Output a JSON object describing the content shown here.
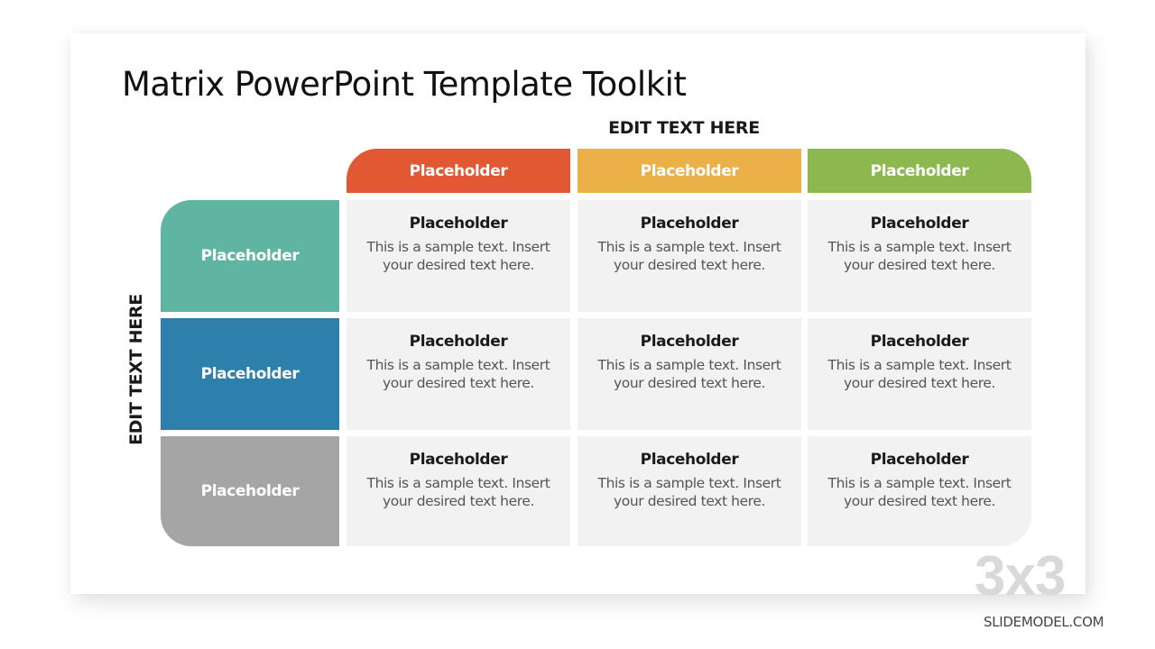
{
  "slide": {
    "title": "Matrix PowerPoint Template Toolkit",
    "top_axis_label": "EDIT TEXT HERE",
    "side_axis_label": "EDIT TEXT HERE",
    "watermark": "3x3",
    "brand": "SLIDEMODEL.COM"
  },
  "columns": [
    {
      "label": "Placeholder",
      "color": "#e25833"
    },
    {
      "label": "Placeholder",
      "color": "#ebb048"
    },
    {
      "label": "Placeholder",
      "color": "#8cb84f"
    }
  ],
  "rows": [
    {
      "label": "Placeholder",
      "color": "#5fb5a1"
    },
    {
      "label": "Placeholder",
      "color": "#2e80ac"
    },
    {
      "label": "Placeholder",
      "color": "#a5a5a5"
    }
  ],
  "cells": [
    [
      {
        "title": "Placeholder",
        "body": "This is a sample text. Insert your desired text here."
      },
      {
        "title": "Placeholder",
        "body": "This is a sample text. Insert your desired text here."
      },
      {
        "title": "Placeholder",
        "body": "This is a sample text. Insert your desired text here."
      }
    ],
    [
      {
        "title": "Placeholder",
        "body": "This is a sample text. Insert your desired text here."
      },
      {
        "title": "Placeholder",
        "body": "This is a sample text. Insert your desired text here."
      },
      {
        "title": "Placeholder",
        "body": "This is a sample text. Insert your desired text here."
      }
    ],
    [
      {
        "title": "Placeholder",
        "body": "This is a sample text. Insert your desired text here."
      },
      {
        "title": "Placeholder",
        "body": "This is a sample text. Insert your desired text here."
      },
      {
        "title": "Placeholder",
        "body": "This is a sample text. Insert your desired text here."
      }
    ]
  ]
}
